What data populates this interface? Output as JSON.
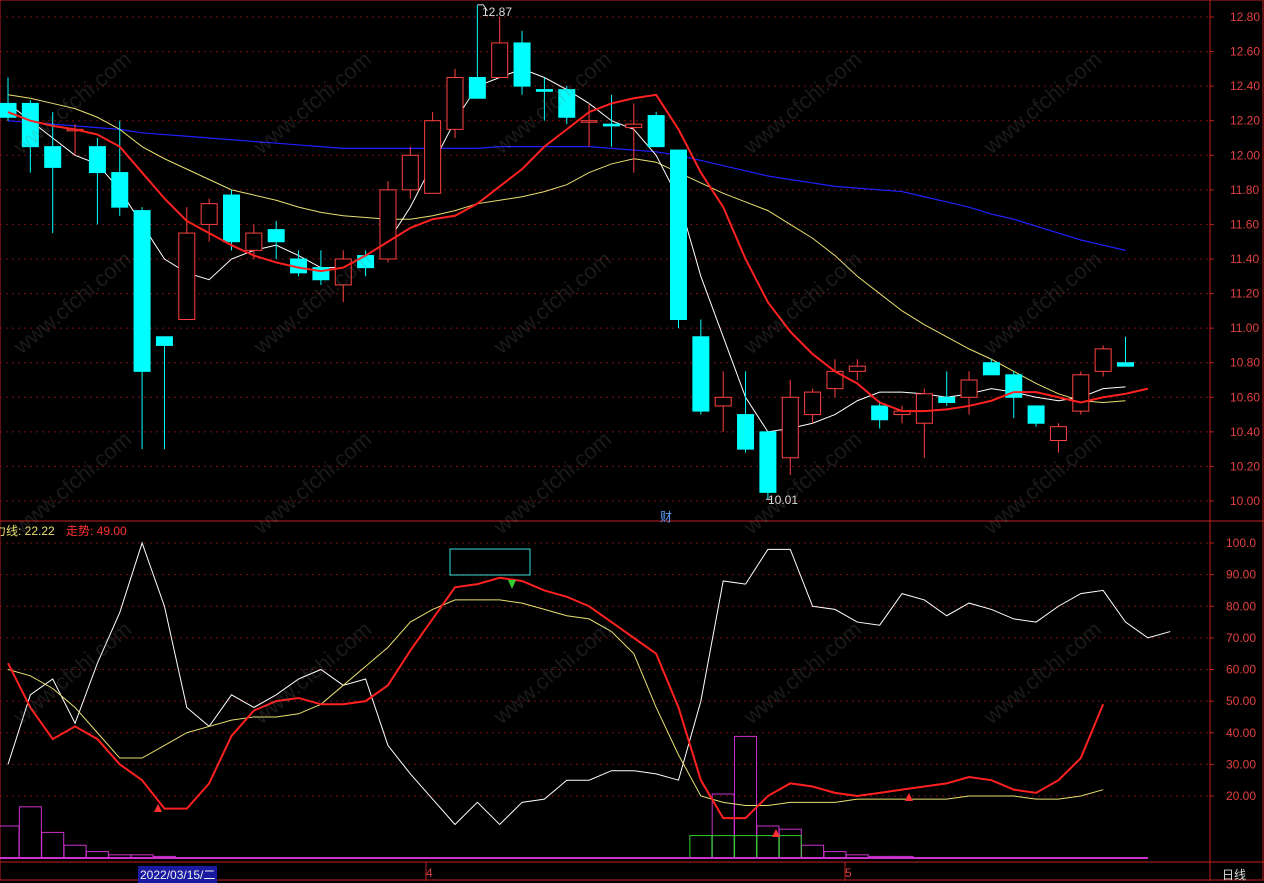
{
  "colors": {
    "background": "#000000",
    "grid": "#7a1010",
    "axis": "#c02020",
    "up_candle": "#ff4040",
    "down_candle": "#00ffff",
    "ma_white": "#ffffff",
    "ma_red": "#ff2020",
    "ma_yellow": "#e8e070",
    "ma_blue": "#2020ff",
    "histogram_magenta": "#cc33cc",
    "histogram_green": "#33cc33"
  },
  "price_axis": {
    "ticks": [
      "12.80",
      "12.60",
      "12.40",
      "12.20",
      "12.00",
      "11.80",
      "11.60",
      "11.40",
      "11.20",
      "11.00",
      "10.80",
      "10.60",
      "10.40",
      "10.20",
      "10.00"
    ]
  },
  "indicator_axis": {
    "ticks": [
      "100.0",
      "90.00",
      "80.00",
      "70.00",
      "60.00",
      "50.00",
      "40.00",
      "30.00",
      "20.00"
    ]
  },
  "annotations": {
    "high_label": "12.87",
    "low_label": "10.01",
    "finance_marker": "财"
  },
  "indicator_legend": {
    "line1": "力线: 22.22",
    "line2": "走势: 49.00"
  },
  "x_axis": {
    "date1": "2022/03/15/二",
    "month1": "4",
    "month2": "5",
    "period": "日线"
  },
  "watermark": "www.cfchi.com",
  "chart_data": {
    "type": "candlestick",
    "period": "日线",
    "ylim": [
      10.0,
      12.9
    ],
    "candles": [
      {
        "o": 12.3,
        "h": 12.45,
        "l": 12.2,
        "c": 12.22
      },
      {
        "o": 12.3,
        "h": 12.32,
        "l": 11.9,
        "c": 12.05
      },
      {
        "o": 12.05,
        "h": 12.25,
        "l": 11.55,
        "c": 11.93
      },
      {
        "o": 12.15,
        "h": 12.18,
        "l": 12.0,
        "c": 12.15
      },
      {
        "o": 12.05,
        "h": 12.1,
        "l": 11.6,
        "c": 11.9
      },
      {
        "o": 11.9,
        "h": 12.2,
        "l": 11.65,
        "c": 11.7
      },
      {
        "o": 11.68,
        "h": 11.7,
        "l": 10.3,
        "c": 10.75
      },
      {
        "o": 10.95,
        "h": 10.95,
        "l": 10.3,
        "c": 10.9
      },
      {
        "o": 11.05,
        "h": 11.7,
        "l": 11.05,
        "c": 11.55
      },
      {
        "o": 11.6,
        "h": 11.75,
        "l": 11.5,
        "c": 11.72
      },
      {
        "o": 11.77,
        "h": 11.8,
        "l": 11.45,
        "c": 11.5
      },
      {
        "o": 11.45,
        "h": 11.6,
        "l": 11.4,
        "c": 11.55
      },
      {
        "o": 11.57,
        "h": 11.62,
        "l": 11.4,
        "c": 11.5
      },
      {
        "o": 11.4,
        "h": 11.45,
        "l": 11.3,
        "c": 11.32
      },
      {
        "o": 11.35,
        "h": 11.45,
        "l": 11.25,
        "c": 11.28
      },
      {
        "o": 11.25,
        "h": 11.45,
        "l": 11.15,
        "c": 11.4
      },
      {
        "o": 11.42,
        "h": 11.45,
        "l": 11.3,
        "c": 11.35
      },
      {
        "o": 11.4,
        "h": 11.85,
        "l": 11.38,
        "c": 11.8
      },
      {
        "o": 11.8,
        "h": 12.05,
        "l": 11.75,
        "c": 12.0
      },
      {
        "o": 11.78,
        "h": 12.25,
        "l": 11.78,
        "c": 12.2
      },
      {
        "o": 12.15,
        "h": 12.5,
        "l": 12.1,
        "c": 12.45
      },
      {
        "o": 12.45,
        "h": 12.87,
        "l": 12.35,
        "c": 12.33
      },
      {
        "o": 12.45,
        "h": 12.8,
        "l": 12.45,
        "c": 12.65
      },
      {
        "o": 12.65,
        "h": 12.72,
        "l": 12.35,
        "c": 12.4
      },
      {
        "o": 12.38,
        "h": 12.45,
        "l": 12.2,
        "c": 12.37
      },
      {
        "o": 12.38,
        "h": 12.4,
        "l": 12.18,
        "c": 12.22
      },
      {
        "o": 12.2,
        "h": 12.3,
        "l": 12.05,
        "c": 12.2
      },
      {
        "o": 12.18,
        "h": 12.35,
        "l": 12.05,
        "c": 12.17
      },
      {
        "o": 12.16,
        "h": 12.3,
        "l": 11.9,
        "c": 12.18
      },
      {
        "o": 12.23,
        "h": 12.25,
        "l": 12.05,
        "c": 12.05
      },
      {
        "o": 12.03,
        "h": 12.03,
        "l": 11.0,
        "c": 11.05
      },
      {
        "o": 10.95,
        "h": 11.05,
        "l": 10.5,
        "c": 10.52
      },
      {
        "o": 10.55,
        "h": 10.75,
        "l": 10.4,
        "c": 10.6
      },
      {
        "o": 10.5,
        "h": 10.75,
        "l": 10.28,
        "c": 10.3
      },
      {
        "o": 10.4,
        "h": 10.4,
        "l": 10.01,
        "c": 10.05
      },
      {
        "o": 10.25,
        "h": 10.7,
        "l": 10.15,
        "c": 10.6
      },
      {
        "o": 10.5,
        "h": 10.65,
        "l": 10.45,
        "c": 10.63
      },
      {
        "o": 10.65,
        "h": 10.82,
        "l": 10.6,
        "c": 10.75
      },
      {
        "o": 10.75,
        "h": 10.82,
        "l": 10.7,
        "c": 10.78
      },
      {
        "o": 10.55,
        "h": 10.58,
        "l": 10.42,
        "c": 10.47
      },
      {
        "o": 10.5,
        "h": 10.55,
        "l": 10.45,
        "c": 10.52
      },
      {
        "o": 10.45,
        "h": 10.65,
        "l": 10.25,
        "c": 10.62
      },
      {
        "o": 10.6,
        "h": 10.75,
        "l": 10.55,
        "c": 10.57
      },
      {
        "o": 10.6,
        "h": 10.75,
        "l": 10.5,
        "c": 10.7
      },
      {
        "o": 10.8,
        "h": 10.82,
        "l": 10.73,
        "c": 10.73
      },
      {
        "o": 10.73,
        "h": 10.75,
        "l": 10.48,
        "c": 10.6
      },
      {
        "o": 10.55,
        "h": 10.55,
        "l": 10.43,
        "c": 10.45
      },
      {
        "o": 10.35,
        "h": 10.45,
        "l": 10.28,
        "c": 10.43
      },
      {
        "o": 10.52,
        "h": 10.75,
        "l": 10.5,
        "c": 10.73
      },
      {
        "o": 10.75,
        "h": 10.9,
        "l": 10.72,
        "c": 10.88
      },
      {
        "o": 10.8,
        "h": 10.95,
        "l": 10.78,
        "c": 10.78
      }
    ],
    "ma_white": [
      12.3,
      12.2,
      12.1,
      12.0,
      11.95,
      11.8,
      11.6,
      11.4,
      11.32,
      11.28,
      11.4,
      11.45,
      11.48,
      11.42,
      11.35,
      11.35,
      11.42,
      11.5,
      11.7,
      11.95,
      12.2,
      12.4,
      12.45,
      12.5,
      12.45,
      12.38,
      12.3,
      12.2,
      12.15,
      12.0,
      11.75,
      11.3,
      10.95,
      10.6,
      10.4,
      10.42,
      10.45,
      10.5,
      10.58,
      10.63,
      10.63,
      10.62,
      10.6,
      10.62,
      10.65,
      10.63,
      10.6,
      10.58,
      10.6,
      10.65,
      10.66
    ],
    "ma_red": [
      12.25,
      12.2,
      12.17,
      12.15,
      12.12,
      12.05,
      11.9,
      11.75,
      11.62,
      11.55,
      11.48,
      11.42,
      11.38,
      11.35,
      11.33,
      11.35,
      11.42,
      11.5,
      11.58,
      11.63,
      11.65,
      11.72,
      11.82,
      11.92,
      12.05,
      12.15,
      12.25,
      12.3,
      12.33,
      12.35,
      12.15,
      11.9,
      11.7,
      11.4,
      11.15,
      10.98,
      10.85,
      10.75,
      10.68,
      10.57,
      10.52,
      10.52,
      10.53,
      10.55,
      10.58,
      10.63,
      10.63,
      10.6,
      10.57,
      10.6,
      10.62,
      10.65
    ],
    "ma_yellow": [
      12.35,
      12.33,
      12.3,
      12.27,
      12.22,
      12.15,
      12.05,
      11.98,
      11.92,
      11.86,
      11.8,
      11.77,
      11.74,
      11.7,
      11.67,
      11.65,
      11.64,
      11.63,
      11.63,
      11.65,
      11.68,
      11.72,
      11.74,
      11.76,
      11.79,
      11.83,
      11.9,
      11.95,
      11.98,
      11.96,
      11.9,
      11.84,
      11.78,
      11.73,
      11.68,
      11.6,
      11.52,
      11.42,
      11.3,
      11.2,
      11.1,
      11.02,
      10.95,
      10.88,
      10.82,
      10.75,
      10.68,
      10.62,
      10.58,
      10.57,
      10.58
    ],
    "ma_blue": [
      12.2,
      12.19,
      12.18,
      12.17,
      12.16,
      12.15,
      12.13,
      12.12,
      12.11,
      12.1,
      12.09,
      12.08,
      12.07,
      12.06,
      12.05,
      12.04,
      12.04,
      12.04,
      12.04,
      12.04,
      12.04,
      12.04,
      12.05,
      12.05,
      12.05,
      12.05,
      12.05,
      12.04,
      12.03,
      12.02,
      12.0,
      11.97,
      11.94,
      11.91,
      11.88,
      11.86,
      11.84,
      11.82,
      11.81,
      11.8,
      11.79,
      11.76,
      11.73,
      11.7,
      11.66,
      11.63,
      11.59,
      11.55,
      11.51,
      11.48,
      11.45
    ],
    "indicator": {
      "ylim": [
        0,
        100
      ],
      "line_white": [
        30,
        52,
        57,
        43,
        62,
        78,
        100,
        80,
        48,
        42,
        52,
        48,
        52,
        57,
        60,
        55,
        57,
        36,
        27,
        19,
        11,
        18,
        11,
        18,
        19,
        25,
        25,
        28,
        28,
        27,
        25,
        50,
        88,
        87,
        98,
        98,
        80,
        79,
        75,
        74,
        84,
        82,
        77,
        81,
        79,
        76,
        75,
        80,
        84,
        85,
        75,
        70,
        72
      ],
      "line_red": [
        62,
        48,
        38,
        42,
        38,
        30,
        25,
        16,
        16,
        24,
        39,
        47,
        50,
        51,
        49,
        49,
        50,
        55,
        66,
        76,
        86,
        87,
        89,
        88,
        85,
        83,
        80,
        75,
        70,
        65,
        48,
        25,
        13,
        13,
        20,
        24,
        23,
        21,
        20,
        21,
        22,
        23,
        24,
        26,
        25,
        22,
        21,
        25,
        32,
        49
      ],
      "line_yellow": [
        60,
        58,
        54,
        48,
        40,
        32,
        32,
        36,
        40,
        42,
        44,
        45,
        45,
        46,
        49,
        55,
        61,
        67,
        75,
        79,
        82,
        82,
        82,
        81,
        79,
        77,
        76,
        72,
        65,
        48,
        33,
        20,
        18,
        17,
        17,
        18,
        18,
        18,
        19,
        19,
        19,
        19,
        19,
        20,
        20,
        20,
        19,
        19,
        20,
        22
      ],
      "histogram_magenta": [
        10,
        16,
        8,
        4,
        2,
        1,
        1,
        0.5,
        0,
        0,
        0,
        0,
        0,
        0,
        0,
        0,
        0,
        0,
        0,
        0,
        0,
        0,
        0,
        0,
        0,
        0,
        0,
        0,
        0,
        0,
        0,
        0,
        20,
        38,
        10,
        9,
        4,
        2,
        1,
        0.5,
        0.5,
        0,
        0,
        0,
        0,
        0,
        0,
        0,
        0,
        0,
        0
      ],
      "histogram_green": [
        0,
        0,
        0,
        0,
        0,
        0,
        0,
        0,
        0,
        0,
        0,
        0,
        0,
        0,
        0,
        0,
        0,
        0,
        0,
        0,
        0,
        0,
        0,
        0,
        0,
        0,
        0,
        0,
        0,
        0,
        0,
        7,
        7,
        7,
        7,
        7,
        0,
        0,
        0,
        0,
        0,
        0,
        0,
        0,
        0,
        0,
        0,
        0,
        0,
        0,
        0
      ]
    }
  }
}
